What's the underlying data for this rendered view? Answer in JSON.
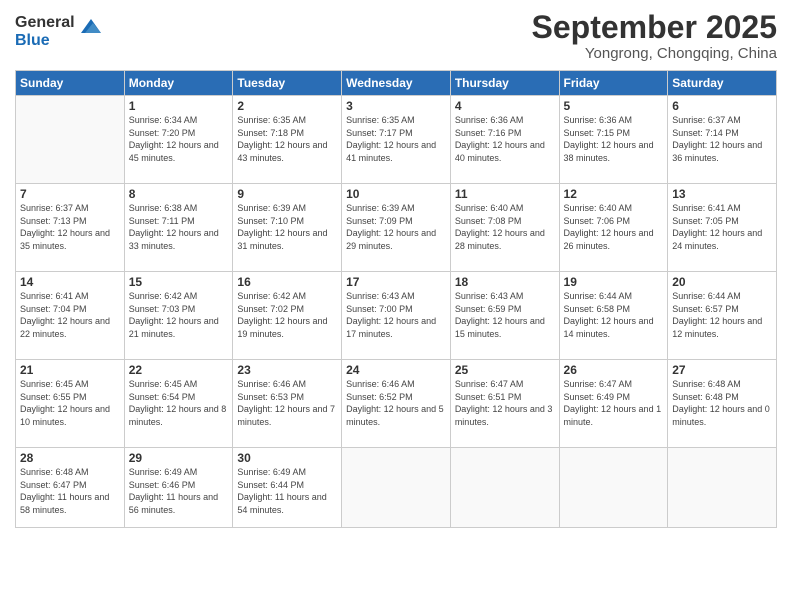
{
  "logo": {
    "general": "General",
    "blue": "Blue"
  },
  "header": {
    "month": "September 2025",
    "location": "Yongrong, Chongqing, China"
  },
  "weekdays": [
    "Sunday",
    "Monday",
    "Tuesday",
    "Wednesday",
    "Thursday",
    "Friday",
    "Saturday"
  ],
  "weeks": [
    [
      {
        "day": "",
        "sunrise": "",
        "sunset": "",
        "daylight": ""
      },
      {
        "day": "1",
        "sunrise": "Sunrise: 6:34 AM",
        "sunset": "Sunset: 7:20 PM",
        "daylight": "Daylight: 12 hours and 45 minutes."
      },
      {
        "day": "2",
        "sunrise": "Sunrise: 6:35 AM",
        "sunset": "Sunset: 7:18 PM",
        "daylight": "Daylight: 12 hours and 43 minutes."
      },
      {
        "day": "3",
        "sunrise": "Sunrise: 6:35 AM",
        "sunset": "Sunset: 7:17 PM",
        "daylight": "Daylight: 12 hours and 41 minutes."
      },
      {
        "day": "4",
        "sunrise": "Sunrise: 6:36 AM",
        "sunset": "Sunset: 7:16 PM",
        "daylight": "Daylight: 12 hours and 40 minutes."
      },
      {
        "day": "5",
        "sunrise": "Sunrise: 6:36 AM",
        "sunset": "Sunset: 7:15 PM",
        "daylight": "Daylight: 12 hours and 38 minutes."
      },
      {
        "day": "6",
        "sunrise": "Sunrise: 6:37 AM",
        "sunset": "Sunset: 7:14 PM",
        "daylight": "Daylight: 12 hours and 36 minutes."
      }
    ],
    [
      {
        "day": "7",
        "sunrise": "Sunrise: 6:37 AM",
        "sunset": "Sunset: 7:13 PM",
        "daylight": "Daylight: 12 hours and 35 minutes."
      },
      {
        "day": "8",
        "sunrise": "Sunrise: 6:38 AM",
        "sunset": "Sunset: 7:11 PM",
        "daylight": "Daylight: 12 hours and 33 minutes."
      },
      {
        "day": "9",
        "sunrise": "Sunrise: 6:39 AM",
        "sunset": "Sunset: 7:10 PM",
        "daylight": "Daylight: 12 hours and 31 minutes."
      },
      {
        "day": "10",
        "sunrise": "Sunrise: 6:39 AM",
        "sunset": "Sunset: 7:09 PM",
        "daylight": "Daylight: 12 hours and 29 minutes."
      },
      {
        "day": "11",
        "sunrise": "Sunrise: 6:40 AM",
        "sunset": "Sunset: 7:08 PM",
        "daylight": "Daylight: 12 hours and 28 minutes."
      },
      {
        "day": "12",
        "sunrise": "Sunrise: 6:40 AM",
        "sunset": "Sunset: 7:06 PM",
        "daylight": "Daylight: 12 hours and 26 minutes."
      },
      {
        "day": "13",
        "sunrise": "Sunrise: 6:41 AM",
        "sunset": "Sunset: 7:05 PM",
        "daylight": "Daylight: 12 hours and 24 minutes."
      }
    ],
    [
      {
        "day": "14",
        "sunrise": "Sunrise: 6:41 AM",
        "sunset": "Sunset: 7:04 PM",
        "daylight": "Daylight: 12 hours and 22 minutes."
      },
      {
        "day": "15",
        "sunrise": "Sunrise: 6:42 AM",
        "sunset": "Sunset: 7:03 PM",
        "daylight": "Daylight: 12 hours and 21 minutes."
      },
      {
        "day": "16",
        "sunrise": "Sunrise: 6:42 AM",
        "sunset": "Sunset: 7:02 PM",
        "daylight": "Daylight: 12 hours and 19 minutes."
      },
      {
        "day": "17",
        "sunrise": "Sunrise: 6:43 AM",
        "sunset": "Sunset: 7:00 PM",
        "daylight": "Daylight: 12 hours and 17 minutes."
      },
      {
        "day": "18",
        "sunrise": "Sunrise: 6:43 AM",
        "sunset": "Sunset: 6:59 PM",
        "daylight": "Daylight: 12 hours and 15 minutes."
      },
      {
        "day": "19",
        "sunrise": "Sunrise: 6:44 AM",
        "sunset": "Sunset: 6:58 PM",
        "daylight": "Daylight: 12 hours and 14 minutes."
      },
      {
        "day": "20",
        "sunrise": "Sunrise: 6:44 AM",
        "sunset": "Sunset: 6:57 PM",
        "daylight": "Daylight: 12 hours and 12 minutes."
      }
    ],
    [
      {
        "day": "21",
        "sunrise": "Sunrise: 6:45 AM",
        "sunset": "Sunset: 6:55 PM",
        "daylight": "Daylight: 12 hours and 10 minutes."
      },
      {
        "day": "22",
        "sunrise": "Sunrise: 6:45 AM",
        "sunset": "Sunset: 6:54 PM",
        "daylight": "Daylight: 12 hours and 8 minutes."
      },
      {
        "day": "23",
        "sunrise": "Sunrise: 6:46 AM",
        "sunset": "Sunset: 6:53 PM",
        "daylight": "Daylight: 12 hours and 7 minutes."
      },
      {
        "day": "24",
        "sunrise": "Sunrise: 6:46 AM",
        "sunset": "Sunset: 6:52 PM",
        "daylight": "Daylight: 12 hours and 5 minutes."
      },
      {
        "day": "25",
        "sunrise": "Sunrise: 6:47 AM",
        "sunset": "Sunset: 6:51 PM",
        "daylight": "Daylight: 12 hours and 3 minutes."
      },
      {
        "day": "26",
        "sunrise": "Sunrise: 6:47 AM",
        "sunset": "Sunset: 6:49 PM",
        "daylight": "Daylight: 12 hours and 1 minute."
      },
      {
        "day": "27",
        "sunrise": "Sunrise: 6:48 AM",
        "sunset": "Sunset: 6:48 PM",
        "daylight": "Daylight: 12 hours and 0 minutes."
      }
    ],
    [
      {
        "day": "28",
        "sunrise": "Sunrise: 6:48 AM",
        "sunset": "Sunset: 6:47 PM",
        "daylight": "Daylight: 11 hours and 58 minutes."
      },
      {
        "day": "29",
        "sunrise": "Sunrise: 6:49 AM",
        "sunset": "Sunset: 6:46 PM",
        "daylight": "Daylight: 11 hours and 56 minutes."
      },
      {
        "day": "30",
        "sunrise": "Sunrise: 6:49 AM",
        "sunset": "Sunset: 6:44 PM",
        "daylight": "Daylight: 11 hours and 54 minutes."
      },
      {
        "day": "",
        "sunrise": "",
        "sunset": "",
        "daylight": ""
      },
      {
        "day": "",
        "sunrise": "",
        "sunset": "",
        "daylight": ""
      },
      {
        "day": "",
        "sunrise": "",
        "sunset": "",
        "daylight": ""
      },
      {
        "day": "",
        "sunrise": "",
        "sunset": "",
        "daylight": ""
      }
    ]
  ]
}
